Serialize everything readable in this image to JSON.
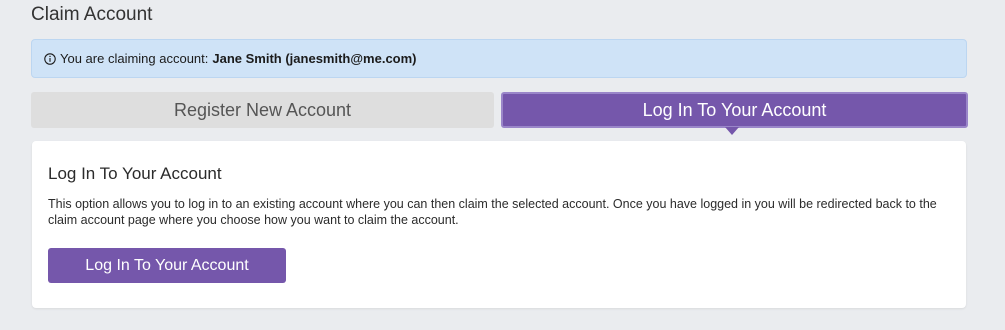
{
  "page": {
    "title": "Claim Account"
  },
  "banner": {
    "prefix": "You are claiming account:",
    "account": "Jane Smith (janesmith@me.com)",
    "icon": "info-icon"
  },
  "tabs": [
    {
      "label": "Register New Account",
      "active": false
    },
    {
      "label": "Log In To Your Account",
      "active": true
    }
  ],
  "panel": {
    "heading": "Log In To Your Account",
    "body": "This option allows you to log in to an existing account where you can then claim the selected account. Once you have logged in you will be redirected back to the claim account page where you choose how you want to claim the account.",
    "button_label": "Log In To Your Account"
  },
  "colors": {
    "accent": "#7557ab",
    "banner_bg": "#cfe3f7",
    "inactive_tab": "#dedede"
  }
}
